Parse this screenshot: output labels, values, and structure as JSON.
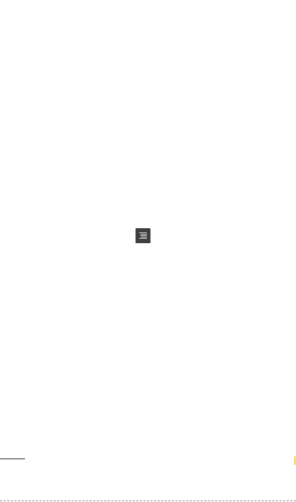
{
  "page": {
    "background": "#ffffff"
  },
  "icons": {
    "menu_key": "menu-key-icon"
  },
  "colors": {
    "icon_background": "#3f3f3f",
    "icon_lines": "#d8d8d8",
    "rule": "#222222",
    "trim_line": "#8a8a8a"
  }
}
